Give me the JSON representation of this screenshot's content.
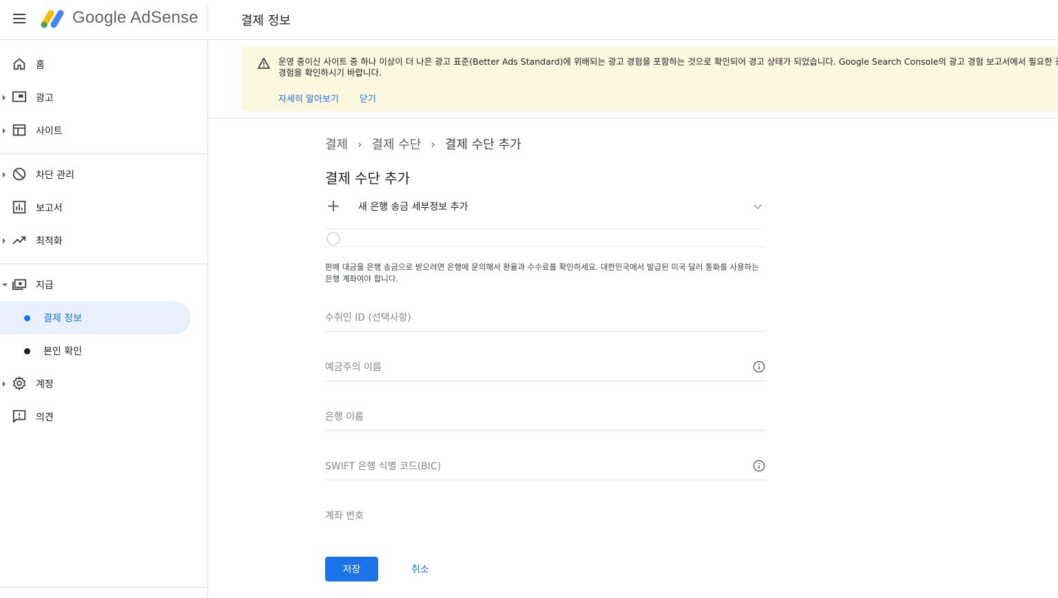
{
  "header": {
    "brand": "Google AdSense",
    "page_title": "결제 정보"
  },
  "sidebar": {
    "items": [
      {
        "label": "홈",
        "icon": "home-icon"
      },
      {
        "label": "광고",
        "icon": "ads-icon"
      },
      {
        "label": "사이트",
        "icon": "sites-icon"
      },
      {
        "label": "차단 관리",
        "icon": "block-icon"
      },
      {
        "label": "보고서",
        "icon": "reports-icon"
      },
      {
        "label": "최적화",
        "icon": "trending-icon"
      },
      {
        "label": "지급",
        "icon": "payments-icon"
      },
      {
        "label": "결제 정보",
        "icon": "dot"
      },
      {
        "label": "본인 확인",
        "icon": "dot"
      },
      {
        "label": "계정",
        "icon": "gear-icon"
      },
      {
        "label": "의견",
        "icon": "feedback-icon"
      }
    ]
  },
  "banner": {
    "message": "운영 중이신 사이트 중 하나 이상이 더 나은 광고 표준(Better Ads Standard)에 위배되는 광고 경험을 포함하는 것으로 확인되어 경고 상태가 되었습니다. Google Search Console의 광고 경험 보고서에서 필요한 광고 경험을 확인하시기 바랍니다.",
    "learn_more": "자세히 알아보기",
    "dismiss": "닫기"
  },
  "breadcrumb": {
    "items": [
      "결제",
      "결제 수단",
      "결제 수단 추가"
    ]
  },
  "form": {
    "title": "결제 수단 추가",
    "add_bank_label": "새 은행 송금 세부정보 추가",
    "helper_text": "판매 대금을 은행 송금으로 받으려면 은행에 문의해서 환율과 수수료를 확인하세요. 대한민국에서 발급된 미국 달러 통화를 사용하는 은행 계좌여야 합니다.",
    "fields": {
      "payee_id": "수취인 ID (선택사항)",
      "account_holder": "예금주의 이름",
      "bank_name": "은행 이름",
      "swift": "SWIFT 은행 식별 코드(BIC)",
      "account_number": "계좌 번호"
    },
    "save": "저장",
    "cancel": "취소"
  },
  "colors": {
    "accent": "#1a73e8",
    "banner_bg": "#fef7e0",
    "active_nav_bg": "#e8f0fe"
  }
}
